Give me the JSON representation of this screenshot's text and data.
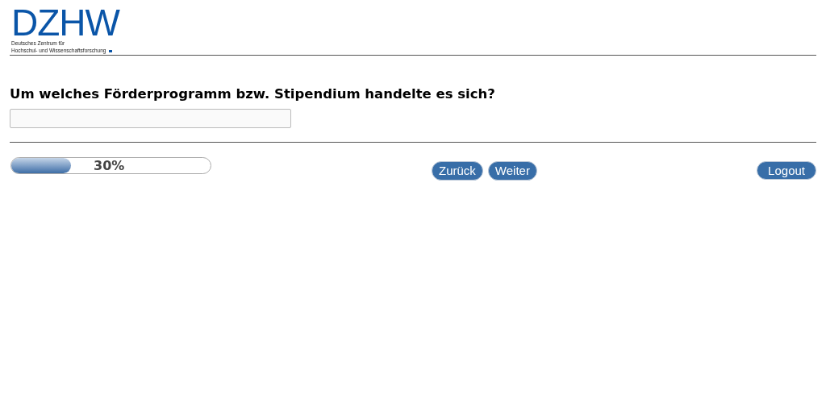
{
  "logo": {
    "wordmark": "DZHW",
    "subtitle_lines": [
      "Deutsches Zentrum für",
      "Hochschul- und Wissenschaftsforschung"
    ]
  },
  "question": {
    "text": "Um welches Förderprogramm bzw. Stipendium handelte es sich?"
  },
  "progress": {
    "level": 0.3,
    "reading": "30%"
  },
  "navigation": [
    "Zurück",
    "Weiter"
  ],
  "logout": "Logout"
}
